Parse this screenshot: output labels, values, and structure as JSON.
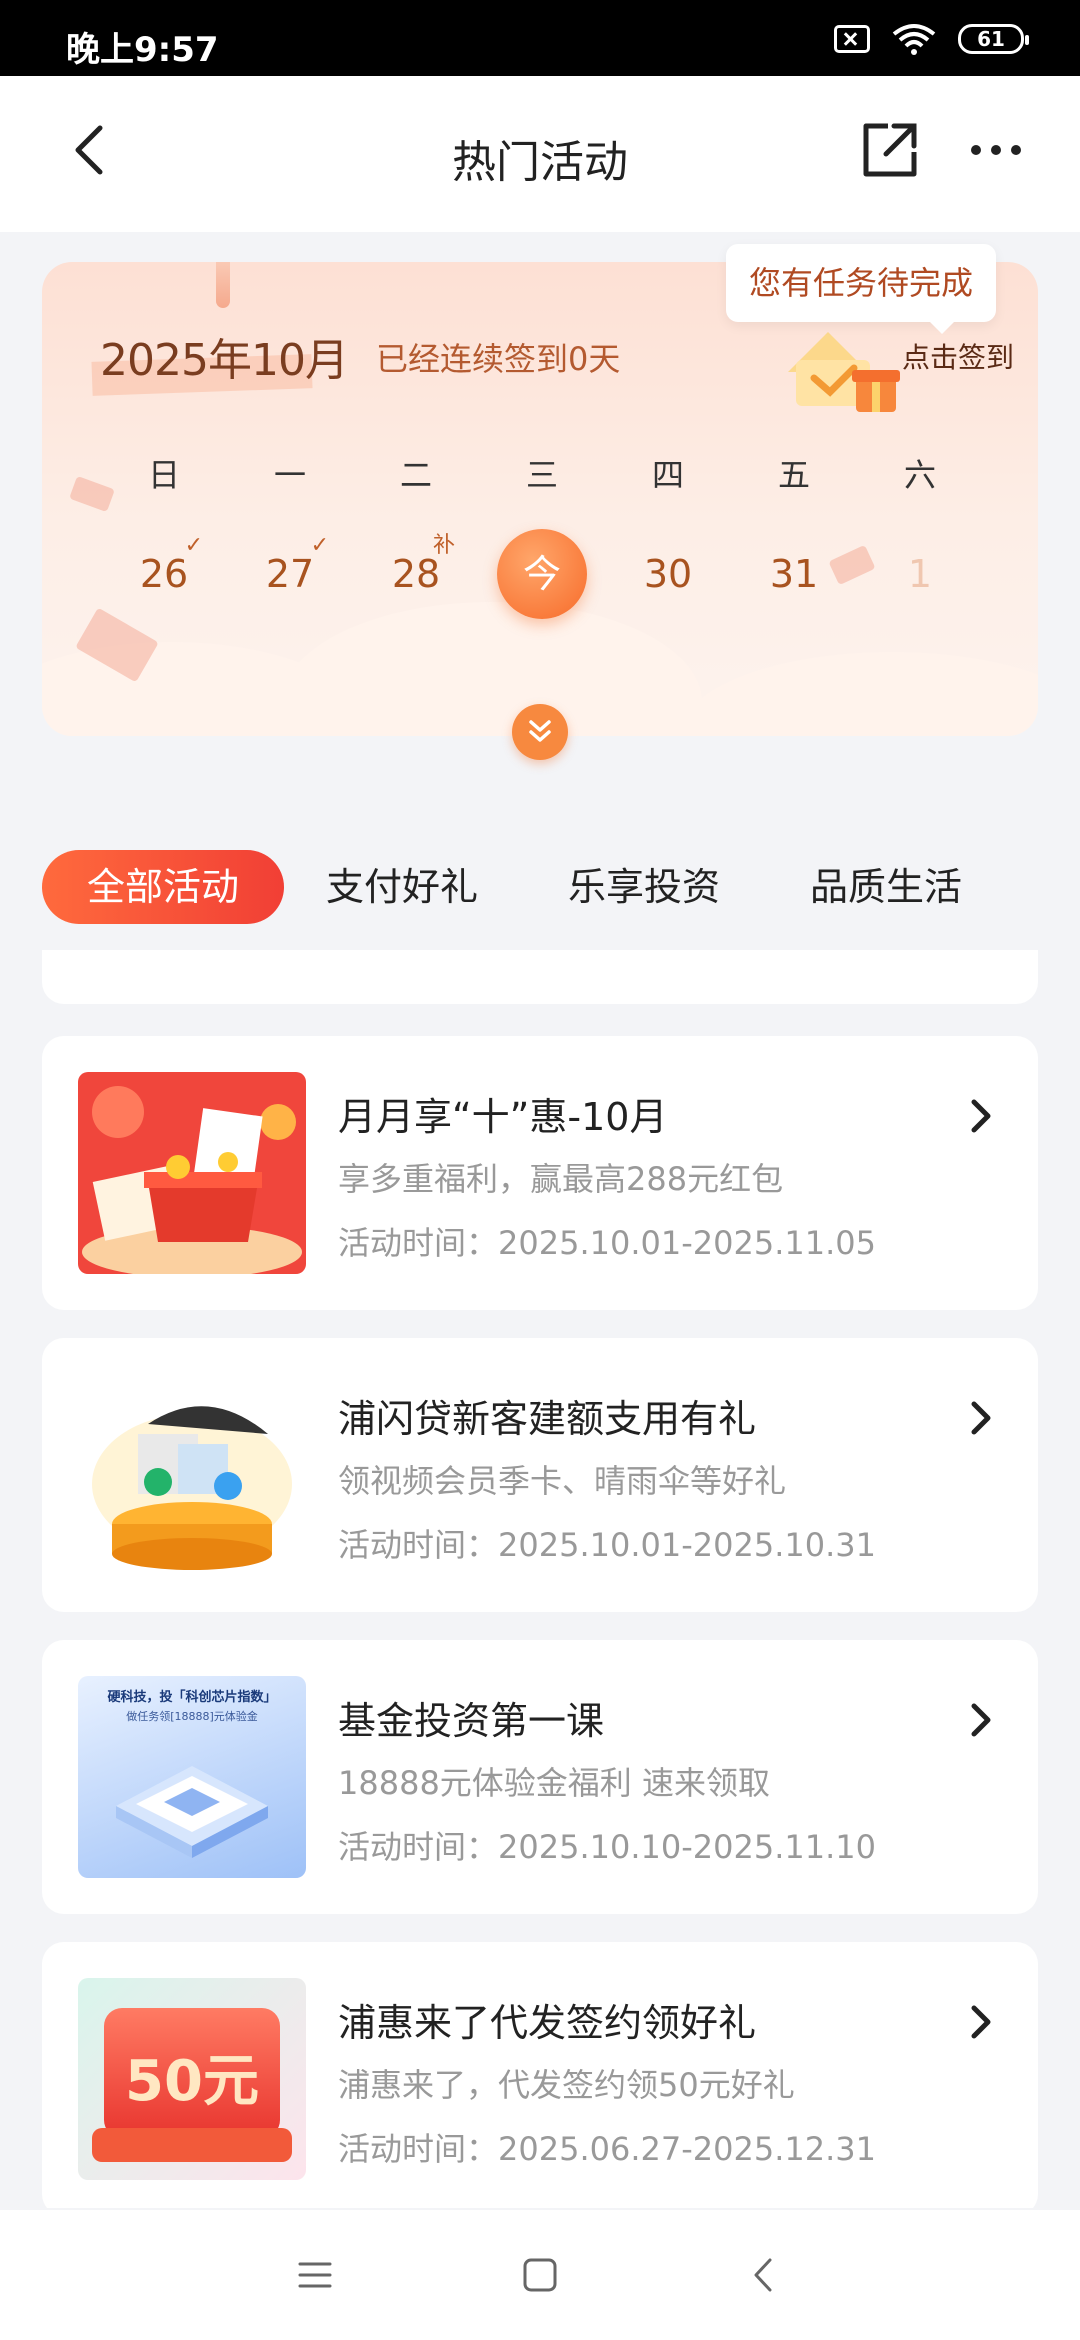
{
  "status_bar": {
    "time": "晚上9:57",
    "battery": "61"
  },
  "nav": {
    "title": "热门活动"
  },
  "calendar": {
    "month": "2025年10月",
    "streak": "已经连续签到0天",
    "tap_to_sign": "点击签到",
    "tooltip": "您有任务待完成",
    "weekdays": [
      "日",
      "一",
      "二",
      "三",
      "四",
      "五",
      "六"
    ],
    "days": [
      {
        "label": "26",
        "mark": "✓"
      },
      {
        "label": "27",
        "mark": "✓"
      },
      {
        "label": "28",
        "mark": "补"
      },
      {
        "label": "今",
        "mark": ""
      },
      {
        "label": "30",
        "mark": ""
      },
      {
        "label": "31",
        "mark": ""
      },
      {
        "label": "1",
        "mark": ""
      }
    ]
  },
  "tabs": [
    "全部活动",
    "支付好礼",
    "乐享投资",
    "品质生活"
  ],
  "activities": [
    {
      "title": "月月享“十”惠-10月",
      "subtitle": "享多重福利，赢最高288元红包",
      "time": "活动时间：2025.10.01-2025.11.05",
      "thumb": "red-gift-box"
    },
    {
      "title": "浦闪贷新客建额支用有礼",
      "subtitle": "领视频会员季卡、晴雨伞等好礼",
      "time": "活动时间：2025.10.01-2025.10.31",
      "thumb": "umbrella-gifts"
    },
    {
      "title": "基金投资第一课",
      "subtitle": "18888元体验金福利 速来领取",
      "time": "活动时间：2025.10.10-2025.11.10",
      "thumb": "chip-platform",
      "thumb_text_1": "硬科技，投「科创芯片指数」",
      "thumb_text_2": "做任务领[18888]元体验金"
    },
    {
      "title": "浦惠来了代发签约领好礼",
      "subtitle": "浦惠来了，代发签约领50元好礼",
      "time": "活动时间：2025.06.27-2025.12.31",
      "thumb": "fifty-yuan-coupon",
      "thumb_badge": "50元"
    }
  ],
  "colors": {
    "accent": "#f24a37",
    "calendar_text": "#a8531f",
    "muted": "#999999"
  }
}
